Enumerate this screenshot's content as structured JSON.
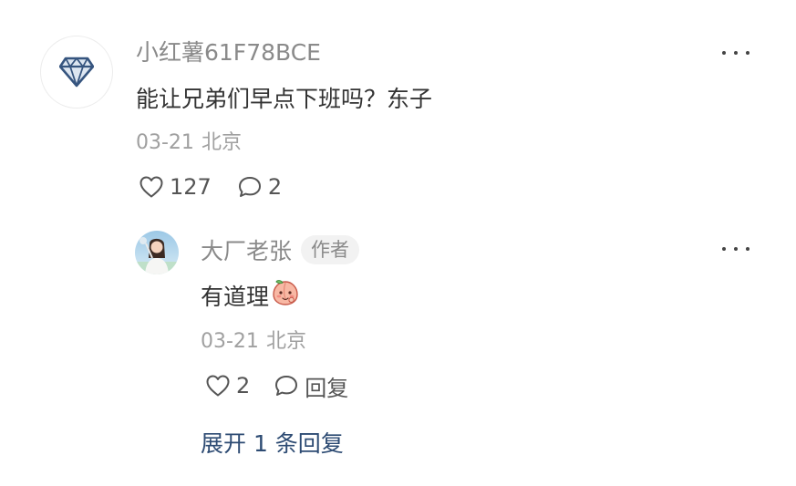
{
  "comment": {
    "author": "小红薯61F78BCE",
    "content": "能让兄弟们早点下班吗？东子",
    "date": "03-21",
    "location": "北京",
    "likes": "127",
    "replies": "2"
  },
  "reply": {
    "author": "大厂老张",
    "author_badge": "作者",
    "content": "有道理",
    "date": "03-21",
    "location": "北京",
    "likes": "2",
    "reply_label": "回复"
  },
  "expand": {
    "label": "展开 1 条回复"
  },
  "colors": {
    "link": "#2d4b73",
    "muted_text": "#8a8a8a",
    "main_text": "#333333"
  },
  "icons": {
    "avatar_main": "diamond-icon",
    "like": "heart-outline-icon",
    "comment": "speech-bubble-icon",
    "more": "ellipsis-icon",
    "emoji": "peach-face-emoji"
  }
}
